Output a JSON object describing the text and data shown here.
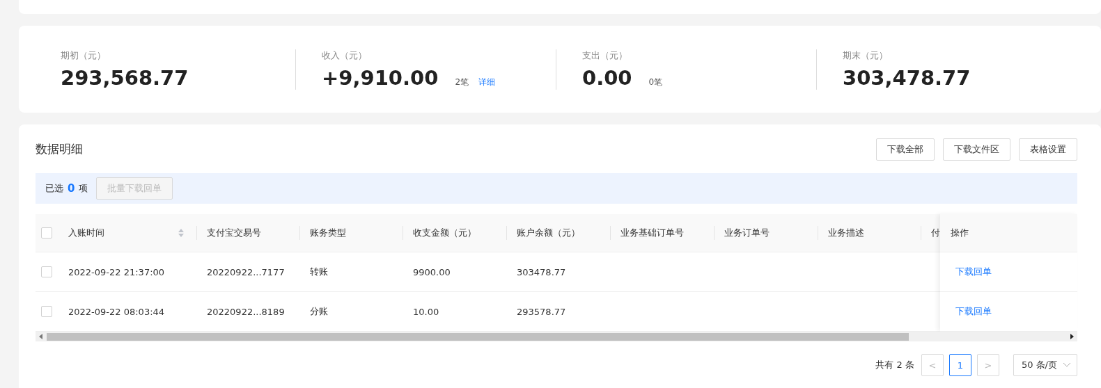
{
  "stats": [
    {
      "label": "期初（元）",
      "value": "293,568.77"
    },
    {
      "label": "收入（元）",
      "value": "+9,910.00",
      "count": "2笔",
      "link": "详细"
    },
    {
      "label": "支出（元）",
      "value": "0.00",
      "count": "0笔"
    },
    {
      "label": "期末（元）",
      "value": "303,478.77"
    }
  ],
  "detail": {
    "title": "数据明细",
    "buttons": [
      "下载全部",
      "下载文件区",
      "表格设置"
    ],
    "selection": {
      "prefix": "已选",
      "count": "0",
      "suffix": "项",
      "button": "批量下载回单",
      "button_disabled": true
    },
    "table": {
      "all_checked": false,
      "columns": [
        "入账时间",
        "支付宝交易号",
        "账务类型",
        "收支金额（元）",
        "账户余额（元）",
        "业务基础订单号",
        "业务订单号",
        "业务描述",
        "付"
      ],
      "action_column": "操作",
      "rows": [
        {
          "checked": false,
          "cells": [
            "2022-09-22 21:37:00",
            "20220922...7177",
            "转账",
            "9900.00",
            "303478.77",
            "",
            "",
            "",
            ""
          ],
          "action": "下载回单"
        },
        {
          "checked": false,
          "cells": [
            "2022-09-22 08:03:44",
            "20220922...8189",
            "分账",
            "10.00",
            "293578.77",
            "",
            "",
            "",
            ""
          ],
          "action": "下载回单"
        }
      ]
    },
    "pagination": {
      "total": "共有 2 条",
      "prev": "<",
      "next": ">",
      "pages": [
        {
          "label": "1",
          "selected": true
        }
      ],
      "page_size": "50 条/页"
    }
  }
}
